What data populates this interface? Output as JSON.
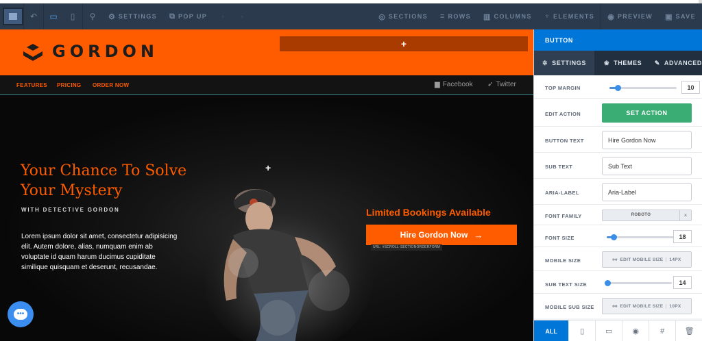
{
  "toolbar": {
    "items": [
      {
        "name": "undo",
        "icon": "undo-icon",
        "label": ""
      },
      {
        "name": "desktop",
        "icon": "desktop-icon",
        "label": ""
      },
      {
        "name": "mobile",
        "icon": "mobile-icon",
        "label": ""
      },
      {
        "name": "plugin",
        "icon": "plug-icon",
        "label": ""
      },
      {
        "name": "settings",
        "icon": "cogs-icon",
        "label": "Settings"
      },
      {
        "name": "popup",
        "icon": "popup-icon",
        "label": "Pop Up"
      },
      {
        "name": "sections",
        "icon": "sections-icon",
        "label": "Sections"
      },
      {
        "name": "rows",
        "icon": "rows-icon",
        "label": "Rows"
      },
      {
        "name": "columns",
        "icon": "columns-icon",
        "label": "Columns"
      },
      {
        "name": "elements",
        "icon": "elements-icon",
        "label": "Elements"
      },
      {
        "name": "preview",
        "icon": "eye-icon",
        "label": "Preview"
      },
      {
        "name": "save",
        "icon": "save-icon",
        "label": "Save"
      }
    ]
  },
  "site": {
    "brand": "GORDON",
    "add_section": "+",
    "nav": [
      "FEATURES",
      "PRICING",
      "ORDER NOW"
    ],
    "social": [
      {
        "icon": "facebook-icon",
        "label": "Facebook"
      },
      {
        "icon": "twitter-icon",
        "label": "Twitter"
      }
    ],
    "hero": {
      "title": "Your Chance To Solve Your Mystery",
      "subtitle": "WITH DETECTIVE GORDON",
      "body": "Lorem ipsum dolor sit amet, consectetur adipisicing elit. Autem dolore, alias, numquam enim ab voluptate id quam harum ducimus cupiditate similique quisquam et deserunt, recusandae.",
      "plus": "+",
      "cta_title": "Limited Bookings Available",
      "cta_button": "Hire Gordon Now",
      "cta_arrow": "→",
      "url_tag": "URL: #SCROLL-SECTIONORDERFORM"
    }
  },
  "panel": {
    "title": "BUTTON",
    "tabs": [
      {
        "icon": "gear-icon",
        "label": "SETTINGS"
      },
      {
        "icon": "palette-icon",
        "label": "THEMES"
      },
      {
        "icon": "wrench-icon",
        "label": "ADVANCED"
      }
    ],
    "top_margin": {
      "label": "TOP MARGIN",
      "value": "10",
      "level": 0.12
    },
    "edit_action": {
      "label": "EDIT ACTION",
      "button": "SET ACTION"
    },
    "button_text": {
      "label": "BUTTON TEXT",
      "value": "Hire Gordon Now"
    },
    "sub_text": {
      "label": "SUB TEXT",
      "placeholder": "Sub Text"
    },
    "aria_label": {
      "label": "ARIA-LABEL",
      "placeholder": "Aria-Label"
    },
    "font_family": {
      "label": "FONT FAMILY",
      "value": "ROBOTO",
      "clear": "×"
    },
    "font_size": {
      "label": "FONT SIZE",
      "value": "18",
      "level": 0.1
    },
    "mobile_size": {
      "label": "MOBILE SIZE",
      "button": "EDIT MOBILE SIZE",
      "value": "14PX"
    },
    "sub_text_size": {
      "label": "SUB TEXT SIZE",
      "value": "14",
      "level": 0.04
    },
    "mobile_sub_size": {
      "label": "MOBILE SUB SIZE",
      "button": "EDIT MOBILE SIZE",
      "value": "10PX"
    },
    "footer": {
      "all": "ALL"
    }
  }
}
